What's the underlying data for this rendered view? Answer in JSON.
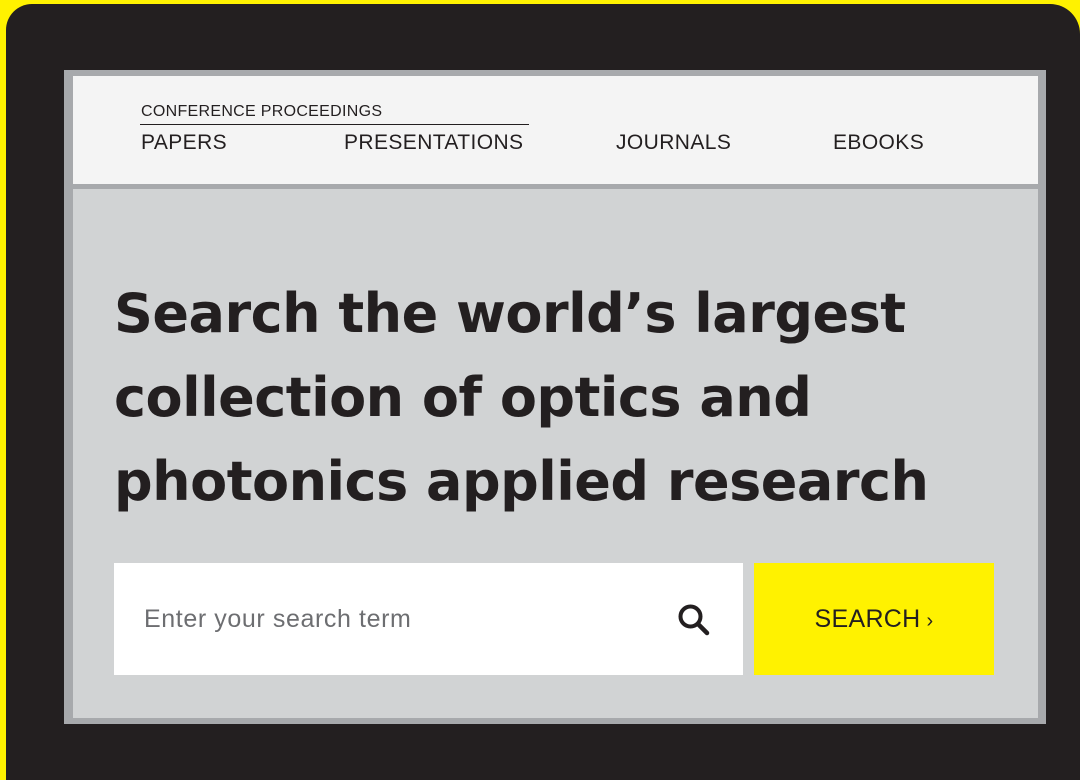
{
  "nav": {
    "group_label": "CONFERENCE PROCEEDINGS",
    "links": [
      {
        "label": "PAPERS"
      },
      {
        "label": "PRESENTATIONS"
      },
      {
        "label": "JOURNALS"
      },
      {
        "label": "EBOOKS"
      }
    ]
  },
  "hero": {
    "headline_lines": [
      "Search the world’s largest",
      "collection of optics and",
      "photonics applied research"
    ]
  },
  "search": {
    "placeholder": "Enter your search term",
    "value": "",
    "button_label": "SEARCH",
    "button_chevron": "›",
    "icon": "search-icon"
  },
  "colors": {
    "accent": "#fff200",
    "frame": "#231f20",
    "hero_background": "#d1d3d4",
    "nav_background": "#f4f4f4"
  }
}
